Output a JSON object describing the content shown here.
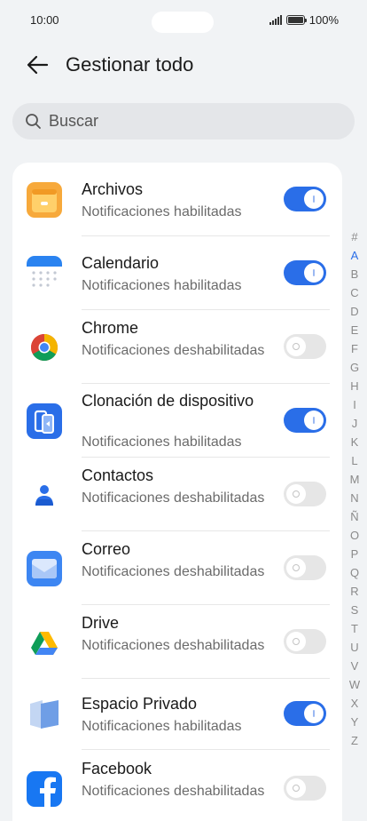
{
  "status": {
    "time": "10:00",
    "battery": "100%"
  },
  "header": {
    "title": "Gestionar todo"
  },
  "search": {
    "placeholder": "Buscar"
  },
  "apps": [
    {
      "name": "Archivos",
      "status": "Notificaciones habilitadas",
      "enabled": true,
      "icon": "files-icon"
    },
    {
      "name": "Calendario",
      "status": "Notificaciones habilitadas",
      "enabled": true,
      "icon": "calendar-icon"
    },
    {
      "name": "Chrome",
      "status": "Notificaciones deshabilitadas",
      "enabled": false,
      "icon": "chrome-icon"
    },
    {
      "name": "Clonación de dispositivo",
      "status": "Notificaciones habilitadas",
      "enabled": true,
      "icon": "device-clone-icon"
    },
    {
      "name": "Contactos",
      "status": "Notificaciones deshabilitadas",
      "enabled": false,
      "icon": "contacts-icon"
    },
    {
      "name": "Correo",
      "status": "Notificaciones deshabilitadas",
      "enabled": false,
      "icon": "mail-icon"
    },
    {
      "name": "Drive",
      "status": "Notificaciones deshabilitadas",
      "enabled": false,
      "icon": "drive-icon"
    },
    {
      "name": "Espacio Privado",
      "status": "Notificaciones habilitadas",
      "enabled": true,
      "icon": "private-space-icon"
    },
    {
      "name": "Facebook",
      "status": "Notificaciones deshabilitadas",
      "enabled": false,
      "icon": "facebook-icon"
    }
  ],
  "alphabet": [
    "#",
    "A",
    "B",
    "C",
    "D",
    "E",
    "F",
    "G",
    "H",
    "I",
    "J",
    "K",
    "L",
    "M",
    "N",
    "Ñ",
    "O",
    "P",
    "Q",
    "R",
    "S",
    "T",
    "U",
    "V",
    "W",
    "X",
    "Y",
    "Z"
  ],
  "alphabet_active": "A",
  "colors": {
    "accent": "#2a6ee8",
    "background": "#f1f3f5"
  }
}
